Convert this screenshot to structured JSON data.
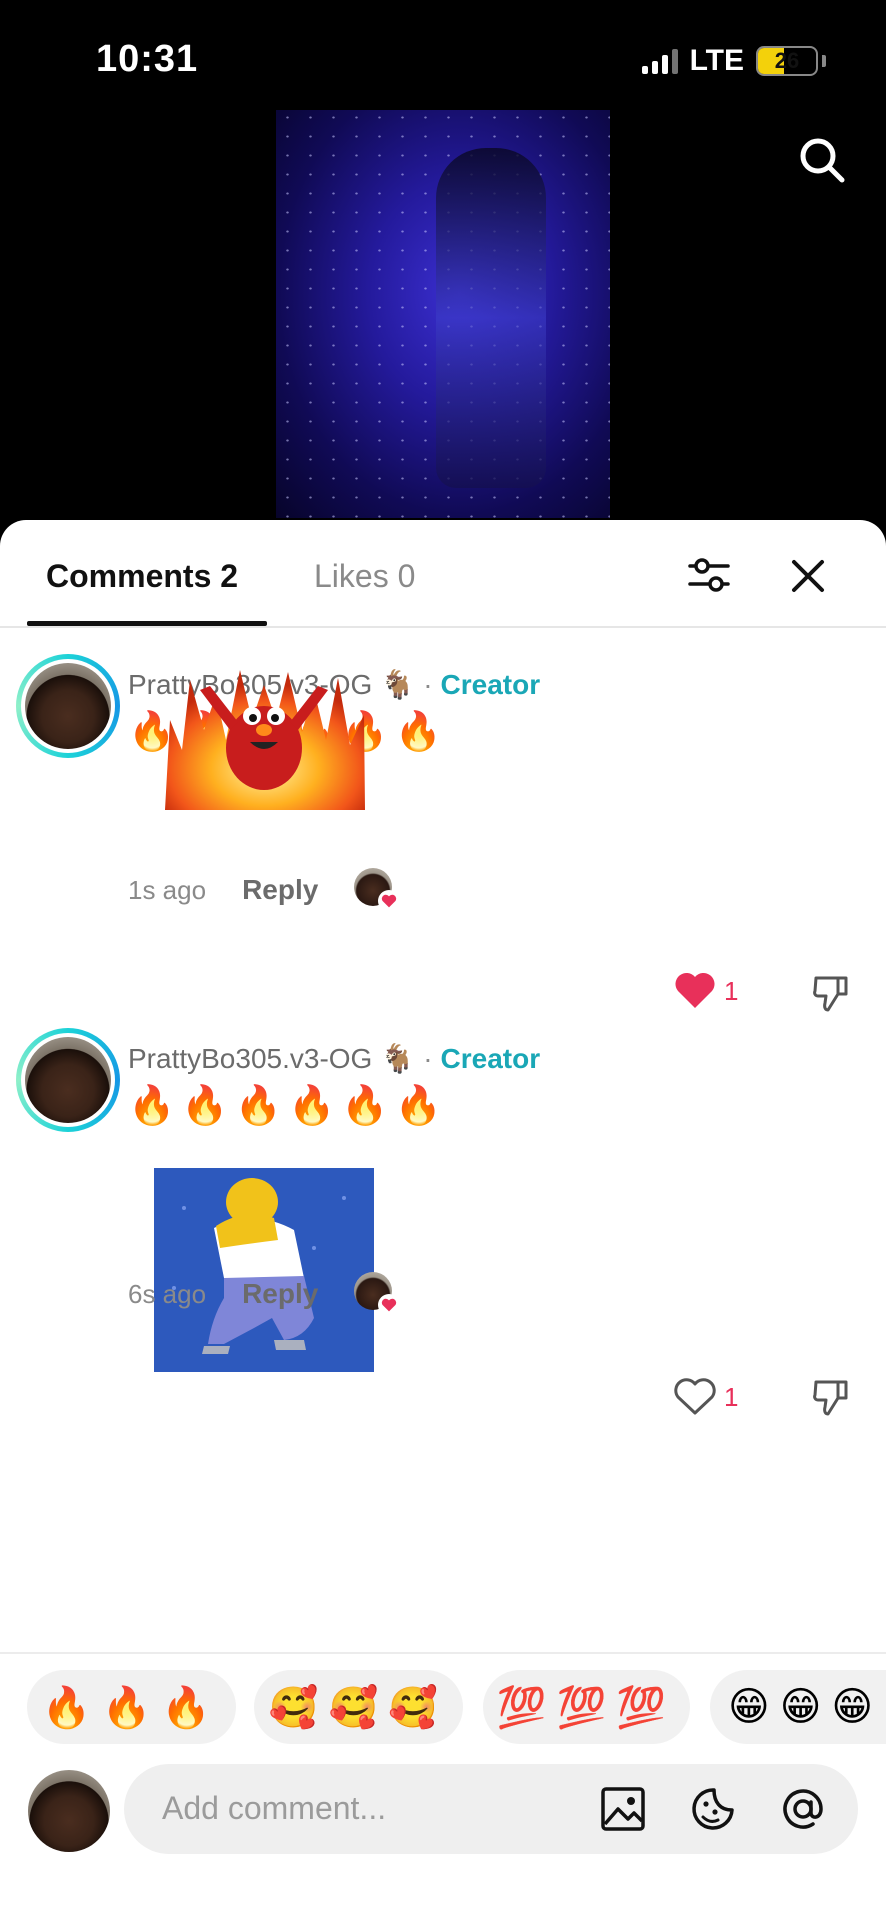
{
  "status_bar": {
    "time": "10:31",
    "network": "LTE",
    "battery": "26"
  },
  "tabs": {
    "comments": "Comments 2",
    "likes": "Likes 0"
  },
  "comments": [
    {
      "username": "PrattyBo305.v3-OG",
      "goat": "🐐",
      "separator": "·",
      "badge": "Creator",
      "text": "🔥🔥🔥🔥🔥🔥",
      "time": "1s ago",
      "reply": "Reply",
      "likes": "1",
      "liked": true
    },
    {
      "username": "PrattyBo305.v3-OG",
      "goat": "🐐",
      "separator": "·",
      "badge": "Creator",
      "text": "🔥🔥🔥🔥🔥🔥",
      "time": "6s ago",
      "reply": "Reply",
      "likes": "1",
      "liked": false
    }
  ],
  "emoji_bar": [
    "🔥🔥🔥",
    "🥰🥰🥰",
    "💯💯💯",
    "😁😁😁"
  ],
  "input": {
    "placeholder": "Add comment..."
  },
  "colors": {
    "accent_creator": "#1aa7b6",
    "like_red": "#e8305a"
  }
}
